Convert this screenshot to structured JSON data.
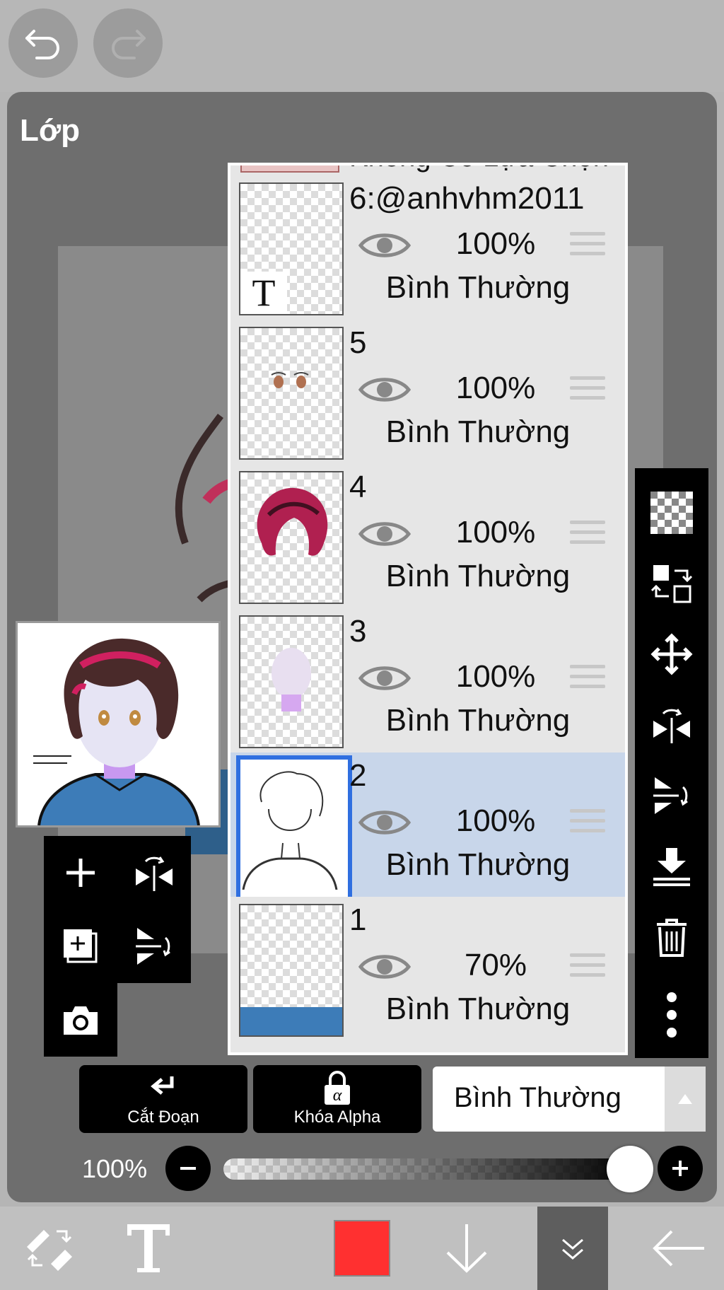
{
  "topbar": {
    "undo": "undo-icon",
    "redo": "redo-icon"
  },
  "panel": {
    "title": "Lớp"
  },
  "layers": [
    {
      "name": "6:@anhvhm2011",
      "opacity": "100%",
      "blend": "Bình Thường",
      "selected": false
    },
    {
      "name": "5",
      "opacity": "100%",
      "blend": "Bình Thường",
      "selected": false
    },
    {
      "name": "4",
      "opacity": "100%",
      "blend": "Bình Thường",
      "selected": false
    },
    {
      "name": "3",
      "opacity": "100%",
      "blend": "Bình Thường",
      "selected": false
    },
    {
      "name": "2",
      "opacity": "100%",
      "blend": "Bình Thường",
      "selected": true
    },
    {
      "name": "1",
      "opacity": "70%",
      "blend": "Bình Thường",
      "selected": false
    }
  ],
  "partial_top_layer": {
    "label": "Không Có Lựa Chọn"
  },
  "right_toolbar": [
    "checker-icon",
    "swap-layers-icon",
    "move-icon",
    "flip-horizontal-icon",
    "flip-vertical-icon",
    "merge-down-icon",
    "trash-icon",
    "more-icon"
  ],
  "left_actions": [
    "add-layer-icon",
    "flip-horizontal-icon",
    "copy-layer-icon",
    "flip-vertical-icon",
    "camera-icon"
  ],
  "controls": {
    "clipping_label": "Cắt Đoạn",
    "alpha_lock_label": "Khóa Alpha",
    "blend_mode": "Bình Thường",
    "opacity_label": "100%",
    "opacity_value": 1.0
  },
  "bottom_toolbar": {
    "tools": [
      "brush-eraser-icon",
      "text-tool-icon",
      "color-swatch",
      "down-arrow-icon",
      "collapse-icon",
      "back-arrow-icon"
    ],
    "current_color": "#ff3030"
  },
  "colors": {
    "selection_blue": "#2f6fe0",
    "selected_row": "#c8d6ea"
  }
}
